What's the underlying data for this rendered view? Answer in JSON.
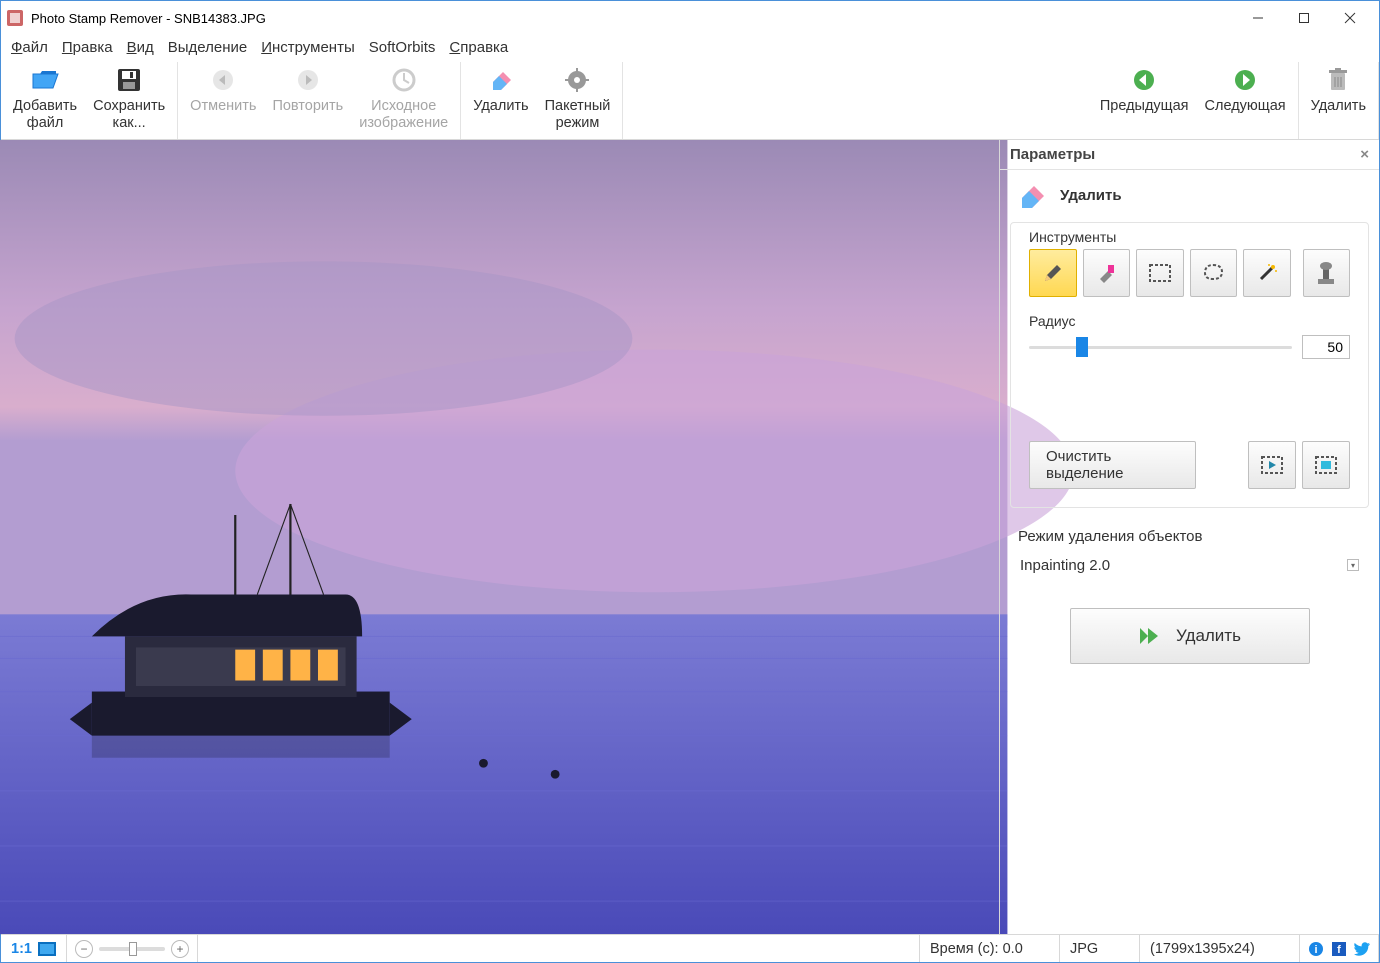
{
  "window": {
    "title": "Photo Stamp Remover - SNB14383.JPG"
  },
  "menubar": {
    "file": "Файл",
    "file_u": "Ф",
    "edit": "Правка",
    "edit_u": "П",
    "view": "Вид",
    "view_u": "В",
    "selection": "Выделение",
    "tools": "Инструменты",
    "tools_u": "И",
    "softorbits": "SoftOrbits",
    "help": "Справка",
    "help_u": "С"
  },
  "toolbar": {
    "add_file_l1": "Добавить",
    "add_file_l2": "файл",
    "add_file_u": "ф",
    "save_as_l1": "Сохранить",
    "save_as_l2": "как...",
    "save_as_u": "С",
    "undo": "Отменить",
    "undo_u": "О",
    "redo": "Повторить",
    "redo_u": "П",
    "original_l1": "Исходное",
    "original_l2": "изображение",
    "remove": "Удалить",
    "batch_l1": "Пакетный",
    "batch_l2": "режим",
    "prev": "Предыдущая",
    "next": "Следующая",
    "delete": "Удалить"
  },
  "side": {
    "panel_title": "Параметры",
    "tool_title": "Удалить",
    "tools_label": "Инструменты",
    "radius_label": "Радиус",
    "radius_value": "50",
    "clear_selection": "Очистить выделение",
    "mode_label": "Режим удаления объектов",
    "mode_value": "Inpainting 2.0",
    "remove_btn": "Удалить"
  },
  "status": {
    "scale": "1:1",
    "time": "Время (с): 0.0",
    "format": "JPG",
    "dims": "(1799x1395x24)"
  }
}
